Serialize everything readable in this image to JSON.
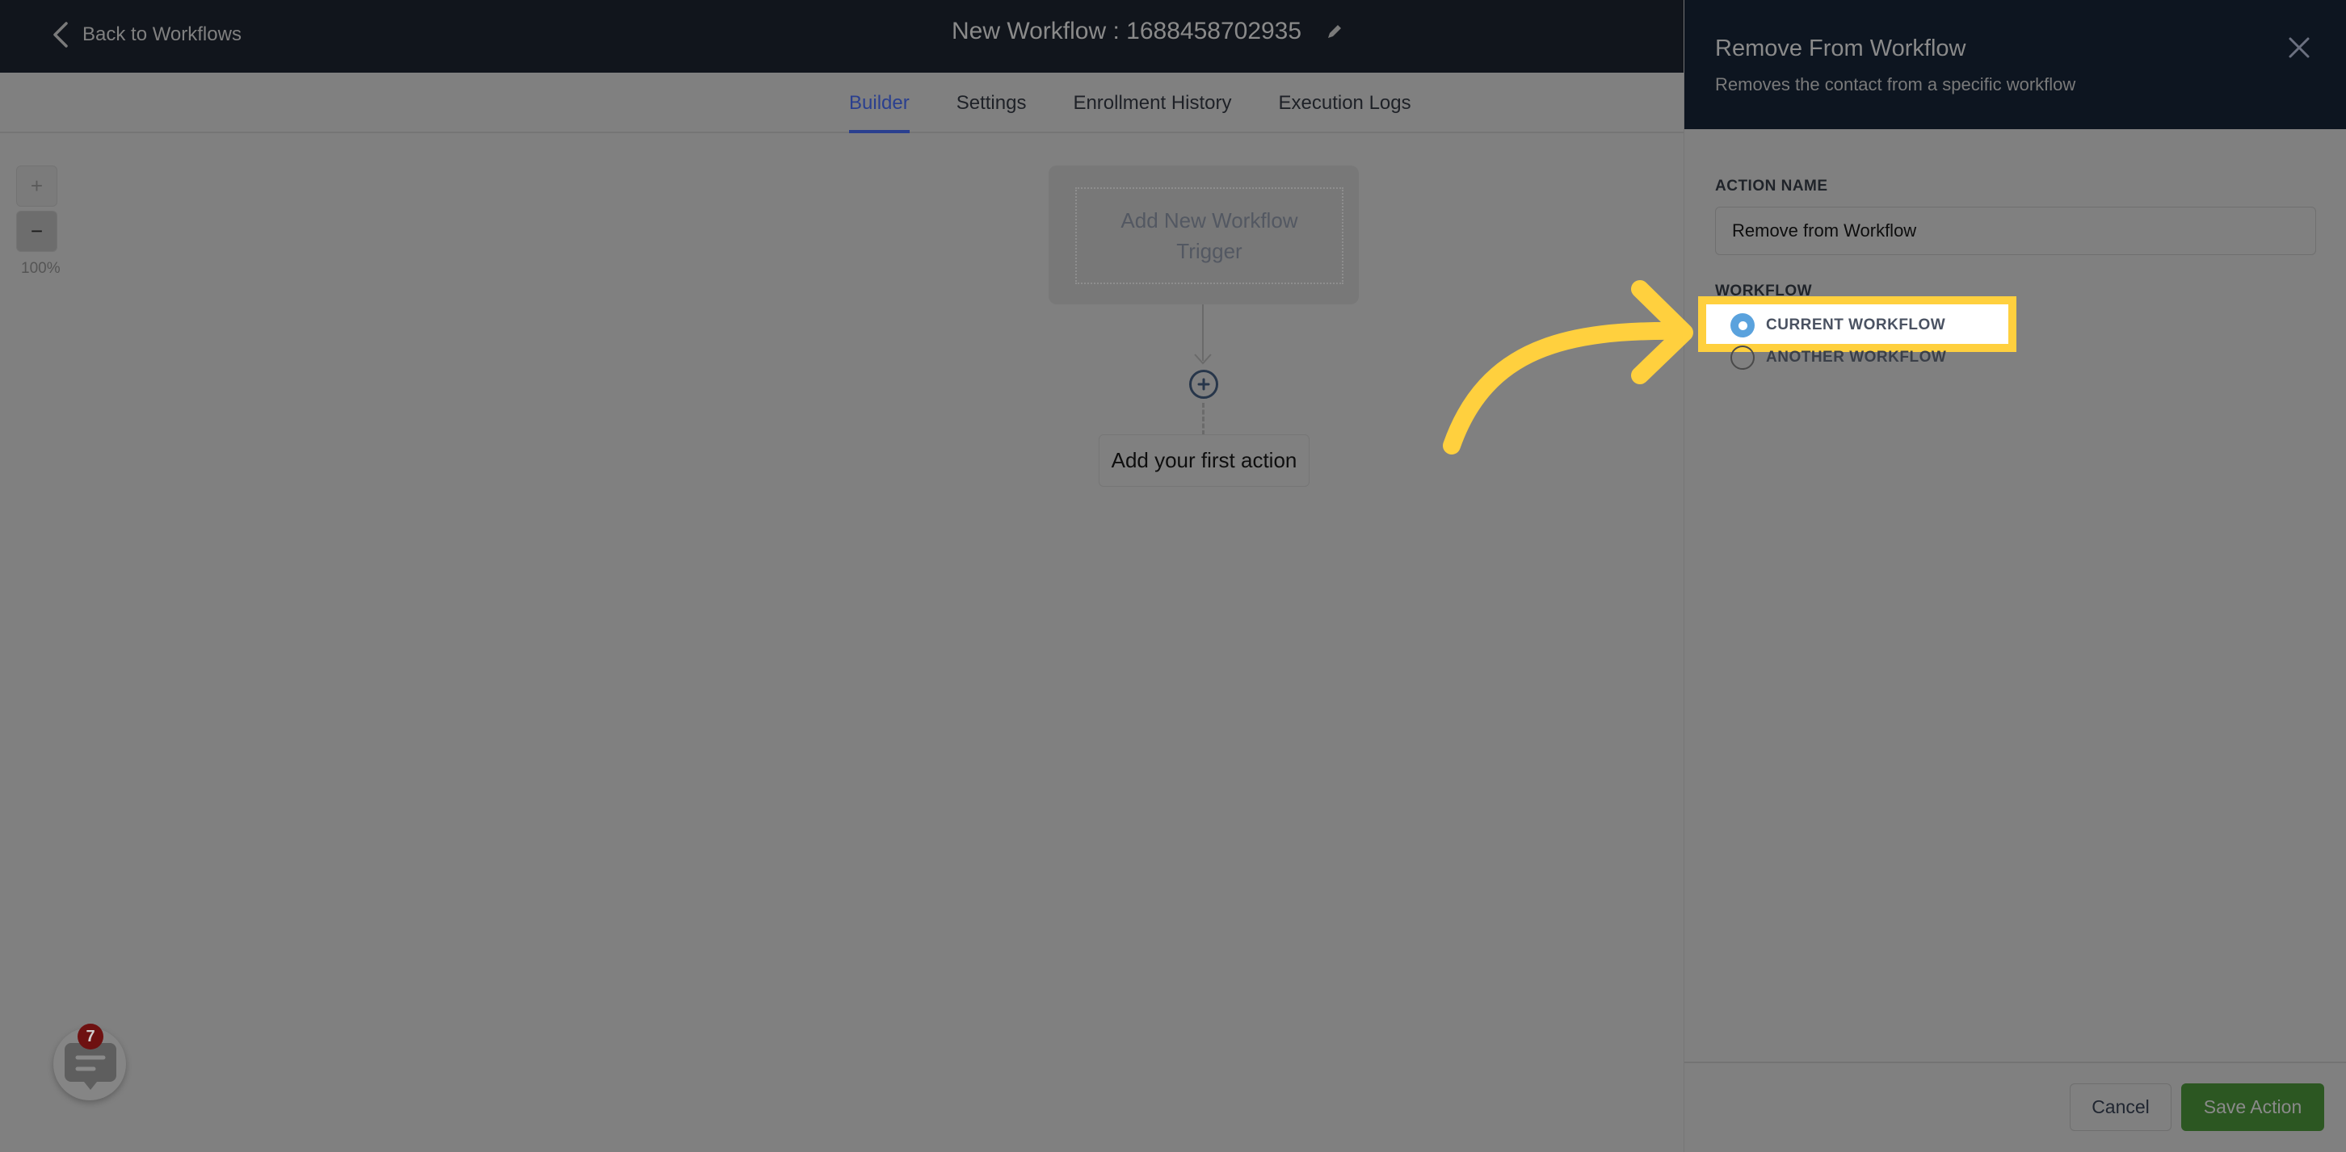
{
  "topbar": {
    "back_label": "Back to Workflows",
    "workflow_title": "New Workflow : 1688458702935",
    "back_icon": "chevron-left-icon",
    "edit_icon": "pencil-icon"
  },
  "tabs": [
    {
      "label": "Builder",
      "active": true
    },
    {
      "label": "Settings",
      "active": false
    },
    {
      "label": "Enrollment History",
      "active": false
    },
    {
      "label": "Execution Logs",
      "active": false
    }
  ],
  "canvas": {
    "zoom_in_label": "+",
    "zoom_out_label": "−",
    "zoom_level": "100%",
    "trigger_line1": "Add New Workflow",
    "trigger_line2": "Trigger",
    "first_action_label": "Add your first action"
  },
  "chat": {
    "badge_count": "7"
  },
  "panel": {
    "title": "Remove From Workflow",
    "subtitle": "Removes the contact from a specific workflow",
    "action_name_label": "ACTION NAME",
    "action_name_value": "Remove from Workflow",
    "workflow_label": "WORKFLOW",
    "options": [
      {
        "label": "CURRENT WORKFLOW",
        "selected": true
      },
      {
        "label": "ANOTHER WORKFLOW",
        "selected": false
      }
    ],
    "cancel_label": "Cancel",
    "save_label": "Save Action"
  },
  "colors": {
    "accent_tab": "#2a3f8f",
    "radio_selected": "#5aa2dd",
    "save_button": "#2c5722",
    "highlight": "#ffd03e",
    "badge": "#6e1111"
  }
}
